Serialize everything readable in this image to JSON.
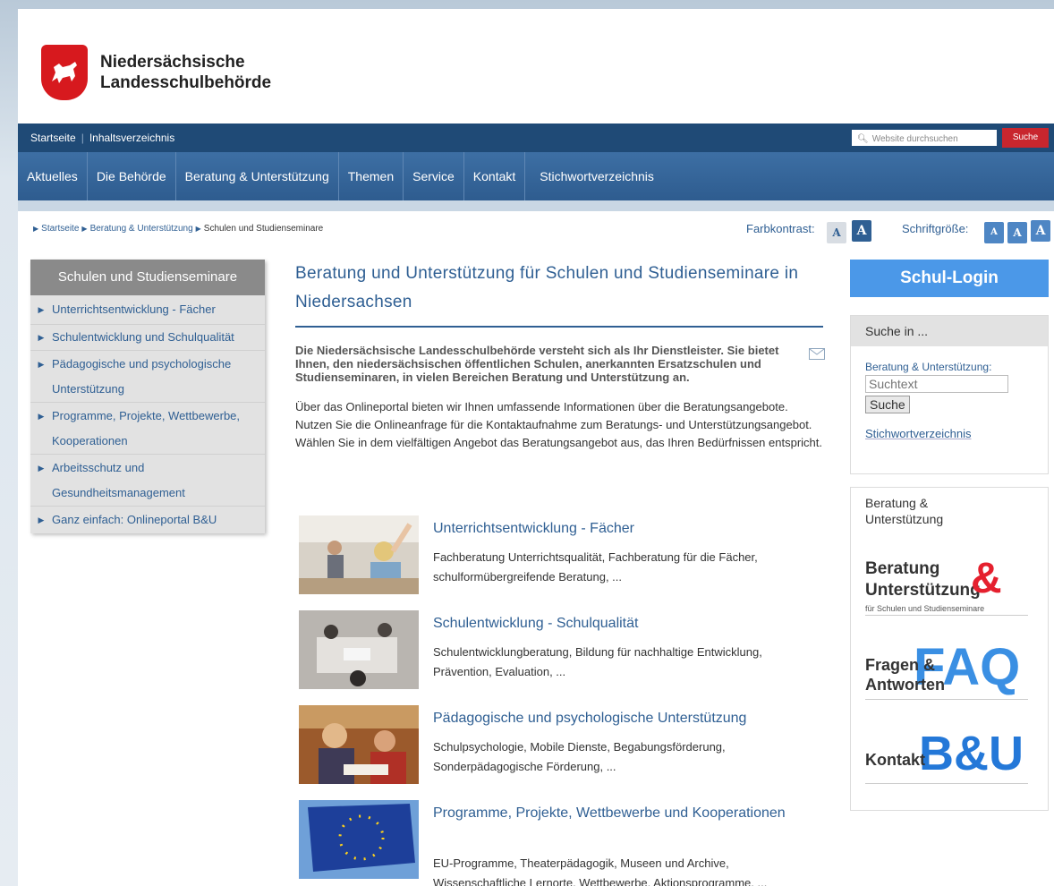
{
  "header": {
    "logo_line1": "Niedersächsische",
    "logo_line2": "Landesschulbehörde"
  },
  "topbar": {
    "links": [
      "Startseite",
      "Inhaltsverzeichnis"
    ],
    "search_placeholder": "Website durchsuchen",
    "search_button": "Suche"
  },
  "mainnav": [
    "Aktuelles",
    "Die Behörde",
    "Beratung & Unterstützung",
    "Themen",
    "Service",
    "Kontakt",
    "Stichwortverzeichnis"
  ],
  "breadcrumb": [
    "Startseite",
    "Beratung & Unterstützung",
    "Schulen und Studienseminare"
  ],
  "tools": {
    "farbkontrast_label": "Farbkontrast:",
    "schriftgroesse_label": "Schriftgröße:",
    "letter": "A"
  },
  "leftnav": {
    "title": "Schulen und Studienseminare",
    "items": [
      "Unterrichtsentwicklung - Fächer",
      "Schulentwicklung und Schulqualität",
      "Pädagogische und psychologische Unterstützung",
      "Programme, Projekte, Wettbewerbe, Kooperationen",
      "Arbeitsschutz und Gesundheitsmanagement",
      "Ganz einfach: Onlineportal B&U"
    ]
  },
  "main": {
    "title": "Beratung und Unterstützung für Schulen und Studienseminare in Niedersachsen",
    "intro": "Die Niedersächsische Landesschulbehörde versteht sich als Ihr Dienstleister. Sie bietet Ihnen, den niedersächsischen öffentlichen Schulen, anerkannten Ersatzschulen und Studienseminaren, in vielen Bereichen Beratung und Unterstützung an.",
    "body": "Über das Onlineportal bieten wir Ihnen umfassende Informationen über die Beratungsangebote. Nutzen Sie die Onlineanfrage für die Kontaktaufnahme zum Beratungs- und Unterstützungsangebot. Wählen Sie in dem vielfältigen Angebot das Beratungsangebot aus, das Ihren Bedürfnissen entspricht.",
    "teasers": [
      {
        "title": "Unterrichtsentwicklung - Fächer",
        "text": "Fachberatung Unterrichtsqualität, Fachberatung für die Fächer, schulformübergreifende Beratung, ..."
      },
      {
        "title": "Schulentwicklung - Schulqualität",
        "text": "Schulentwicklungberatung, Bildung für nachhaltige Entwicklung, Prävention, Evaluation, ..."
      },
      {
        "title": "Pädagogische und psychologische Unterstützung",
        "text": "Schulpsychologie, Mobile Dienste, Begabungsförderung, Sonderpädagogische Förderung, ..."
      },
      {
        "title": "Programme, Projekte, Wettbewerbe und Kooperationen",
        "text": "EU-Programme, Theaterpädagogik, Museen und Archive, Wissenschaftliche Lernorte, Wettbewerbe, Aktionsprogramme, ..."
      }
    ]
  },
  "right": {
    "login": "Schul-Login",
    "search_box_title": "Suche in ...",
    "search_label": "Beratung & Unterstützung:",
    "search_placeholder": "Suchtext",
    "search_button": "Suche",
    "stichwort_link": "Stichwortverzeichnis",
    "bu_box_title": "Beratung & Unterstützung",
    "promo1_line1": "Beratung",
    "promo1_line2": "Unterstützung",
    "promo1_amp": "&",
    "promo1_sub": "für Schulen und Studienseminare",
    "promo2_line1": "Fragen &",
    "promo2_line2": "Antworten",
    "promo2_big": "FAQ",
    "promo3_small": "Kontakt",
    "promo3_big": "B&U"
  },
  "colors": {
    "nav_dark": "#1f4a76",
    "nav": "#3d6fa4",
    "link": "#2f5f93",
    "accent_red": "#c8262e",
    "login_blue": "#4b98e8",
    "promo_red": "#e5202e"
  }
}
